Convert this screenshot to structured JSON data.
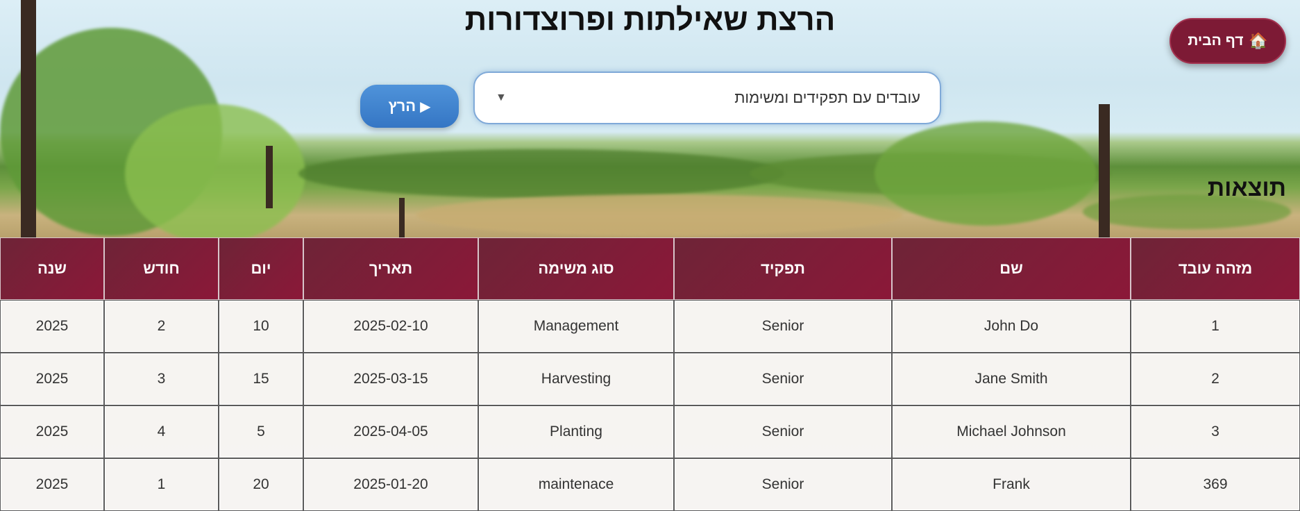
{
  "page": {
    "title": "הרצת שאילתות ופרוצדורות"
  },
  "home_button": {
    "icon": "house-icon",
    "icon_glyph": "🏠",
    "label": "דף הבית"
  },
  "query_select": {
    "selected": "עובדים עם תפקידים ומשימות"
  },
  "run_button": {
    "icon": "play-icon",
    "icon_glyph": "▶",
    "label": "הרץ"
  },
  "results": {
    "heading": "תוצאות",
    "columns": [
      "מזהה עובד",
      "שם",
      "תפקיד",
      "סוג משימה",
      "תאריך",
      "יום",
      "חודש",
      "שנה"
    ],
    "rows": [
      [
        "1",
        "John Do",
        "Senior",
        "Management",
        "2025-02-10",
        "10",
        "2",
        "2025"
      ],
      [
        "2",
        "Jane Smith",
        "Senior",
        "Harvesting",
        "2025-03-15",
        "15",
        "3",
        "2025"
      ],
      [
        "3",
        "Michael Johnson",
        "Senior",
        "Planting",
        "2025-04-05",
        "5",
        "4",
        "2025"
      ],
      [
        "369",
        "Frank",
        "Senior",
        "maintenace",
        "2025-01-20",
        "20",
        "1",
        "2025"
      ]
    ]
  },
  "colors": {
    "header_bg": "#7d1a35",
    "home_button_bg": "#7d1a35",
    "run_button_bg": "#3b7fcb",
    "select_border": "#7fa9d8"
  }
}
